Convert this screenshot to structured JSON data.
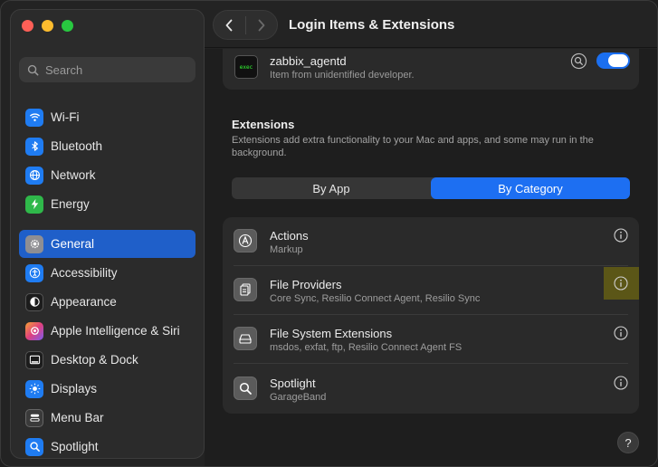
{
  "window": {
    "title": "Login Items & Extensions"
  },
  "sidebar": {
    "search_placeholder": "Search",
    "items": [
      {
        "label": "Wi-Fi",
        "icon": "wifi-icon",
        "color": "#1f7cf2"
      },
      {
        "label": "Bluetooth",
        "icon": "bluetooth-icon",
        "color": "#1f7cf2"
      },
      {
        "label": "Network",
        "icon": "globe-icon",
        "color": "#1f7cf2"
      },
      {
        "label": "Energy",
        "icon": "bolt-icon",
        "color": "#2fb84a"
      },
      {
        "label": "General",
        "icon": "gear-icon",
        "color": "#8e8e93",
        "active": true
      },
      {
        "label": "Accessibility",
        "icon": "accessibility-icon",
        "color": "#1f7cf2"
      },
      {
        "label": "Appearance",
        "icon": "appearance-icon",
        "color": "#1c1c1c"
      },
      {
        "label": "Apple Intelligence & Siri",
        "icon": "siri-icon",
        "color": "#d44bd0"
      },
      {
        "label": "Desktop & Dock",
        "icon": "dock-icon",
        "color": "#1c1c1c"
      },
      {
        "label": "Displays",
        "icon": "sun-icon",
        "color": "#1f7cf2"
      },
      {
        "label": "Menu Bar",
        "icon": "menubar-icon",
        "color": "#3a3a3a"
      },
      {
        "label": "Spotlight",
        "icon": "spotlight-icon",
        "color": "#1f7cf2"
      }
    ]
  },
  "login_item": {
    "name": "zabbix_agentd",
    "subtitle": "Item from unidentified developer.",
    "enabled": true
  },
  "extensions": {
    "title": "Extensions",
    "description": "Extensions add extra functionality to your Mac and apps, and some may run in the background.",
    "tabs": [
      "By App",
      "By Category"
    ],
    "selected_tab": "By Category",
    "rows": [
      {
        "title": "Actions",
        "subtitle": "Markup",
        "icon": "actions-icon"
      },
      {
        "title": "File Providers",
        "subtitle": "Core Sync, Resilio Connect Agent, Resilio Sync",
        "icon": "file-providers-icon",
        "highlighted": true
      },
      {
        "title": "File System Extensions",
        "subtitle": "msdos, exfat, ftp, Resilio Connect Agent FS",
        "icon": "drive-icon"
      },
      {
        "title": "Spotlight",
        "subtitle": "GarageBand",
        "icon": "spotlight-search-icon"
      }
    ]
  },
  "help": {
    "label": "?"
  },
  "colors": {
    "accent": "#1d6ff2",
    "highlight": "#5b5617"
  }
}
